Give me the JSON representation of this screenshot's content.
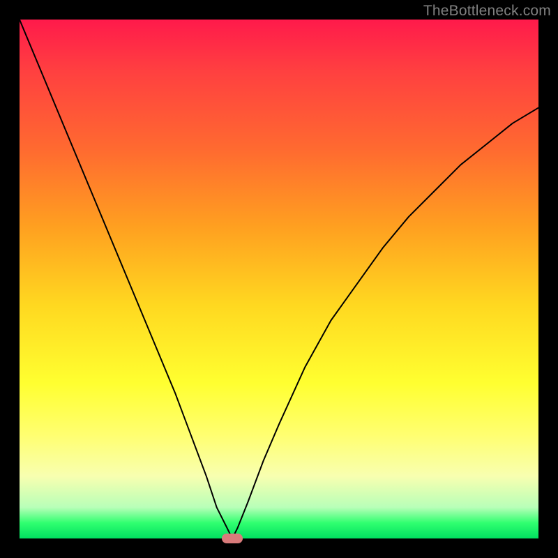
{
  "watermark": "TheBottleneck.com",
  "colors": {
    "curve_stroke": "#000000",
    "frame_bg": "#000000",
    "marker_fill": "#d97b7b"
  },
  "chart_data": {
    "type": "line",
    "title": "",
    "xlabel": "",
    "ylabel": "",
    "xlim": [
      0,
      100
    ],
    "ylim": [
      0,
      100
    ],
    "grid": false,
    "legend": false,
    "annotations": [
      {
        "text": "TheBottleneck.com",
        "position": "top-right"
      }
    ],
    "series": [
      {
        "name": "bottleneck-curve",
        "x": [
          0,
          5,
          10,
          15,
          20,
          25,
          30,
          33,
          36,
          38,
          40,
          41,
          42,
          44,
          47,
          50,
          55,
          60,
          65,
          70,
          75,
          80,
          85,
          90,
          95,
          100
        ],
        "y": [
          100,
          88,
          76,
          64,
          52,
          40,
          28,
          20,
          12,
          6,
          2,
          0,
          2,
          7,
          15,
          22,
          33,
          42,
          49,
          56,
          62,
          67,
          72,
          76,
          80,
          83
        ]
      }
    ],
    "marker": {
      "x": 41,
      "y": 0,
      "width_pct": 4,
      "height_pct": 2
    }
  }
}
